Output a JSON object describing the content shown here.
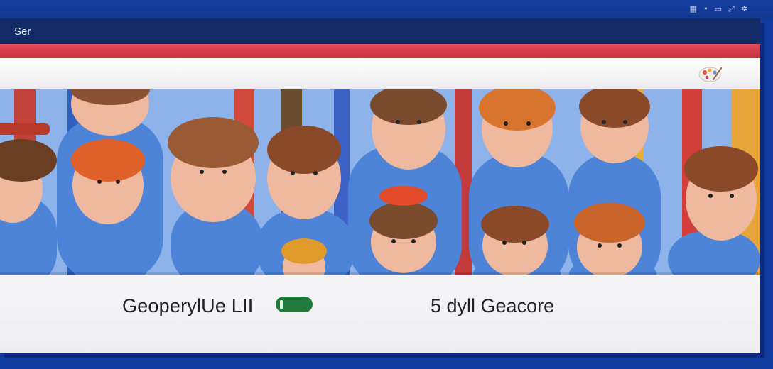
{
  "system_tray": {
    "icons": [
      "grid-icon",
      "dot-icon",
      "screen-icon",
      "expand-icon",
      "settings-icon"
    ],
    "glyphs": [
      "▦",
      "•",
      "▭",
      "⤢",
      "✲"
    ]
  },
  "window": {
    "title": "Ser"
  },
  "toolbar": {
    "icon": "palette-icon"
  },
  "banner": {
    "subject": "group-illustration"
  },
  "footer": {
    "left_label": "GeoperylUe LII",
    "right_label": "5 dyll Geacore"
  },
  "colors": {
    "desktop": "#0f3a9e",
    "titlebar": "#122a66",
    "accent": "#d8404e",
    "toggle": "#1f7a3c"
  }
}
